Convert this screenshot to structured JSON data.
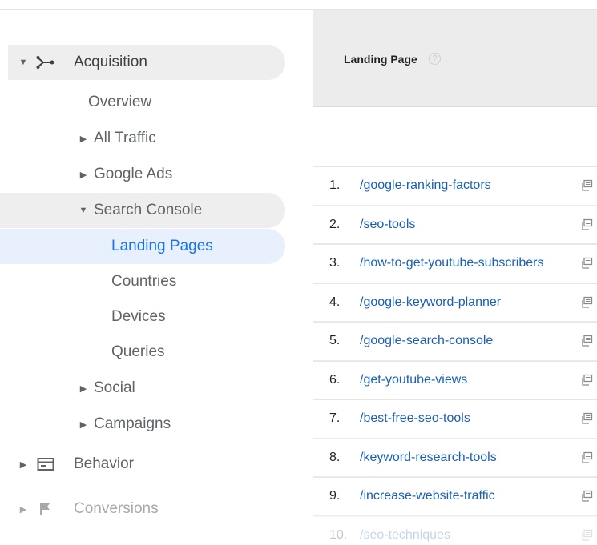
{
  "sidebar": {
    "sections": [
      {
        "label": "Acquisition",
        "icon": "acquisition-icon"
      },
      {
        "label": "Behavior",
        "icon": "behavior-icon"
      },
      {
        "label": "Conversions",
        "icon": "flag-icon"
      }
    ],
    "acquisition_items": [
      {
        "label": "Overview"
      },
      {
        "label": "All Traffic"
      },
      {
        "label": "Google Ads"
      },
      {
        "label": "Search Console"
      },
      {
        "label": "Social"
      },
      {
        "label": "Campaigns"
      }
    ],
    "search_console_items": [
      {
        "label": "Landing Pages"
      },
      {
        "label": "Countries"
      },
      {
        "label": "Devices"
      },
      {
        "label": "Queries"
      }
    ]
  },
  "table": {
    "header": {
      "landing_page": "Landing Page"
    },
    "rows": [
      {
        "num": "1.",
        "page": "/google-ranking-factors"
      },
      {
        "num": "2.",
        "page": "/seo-tools"
      },
      {
        "num": "3.",
        "page": "/how-to-get-youtube-subscribers"
      },
      {
        "num": "4.",
        "page": "/google-keyword-planner"
      },
      {
        "num": "5.",
        "page": "/google-search-console"
      },
      {
        "num": "6.",
        "page": "/get-youtube-views"
      },
      {
        "num": "7.",
        "page": "/best-free-seo-tools"
      },
      {
        "num": "8.",
        "page": "/keyword-research-tools"
      },
      {
        "num": "9.",
        "page": "/increase-website-traffic"
      },
      {
        "num": "10.",
        "page": "/seo-techniques"
      }
    ]
  },
  "colors": {
    "accent": "#1a73e8",
    "link": "#1a5fb4",
    "selected_bg": "#e8f0fe",
    "hover_bg": "#eeeeee"
  }
}
